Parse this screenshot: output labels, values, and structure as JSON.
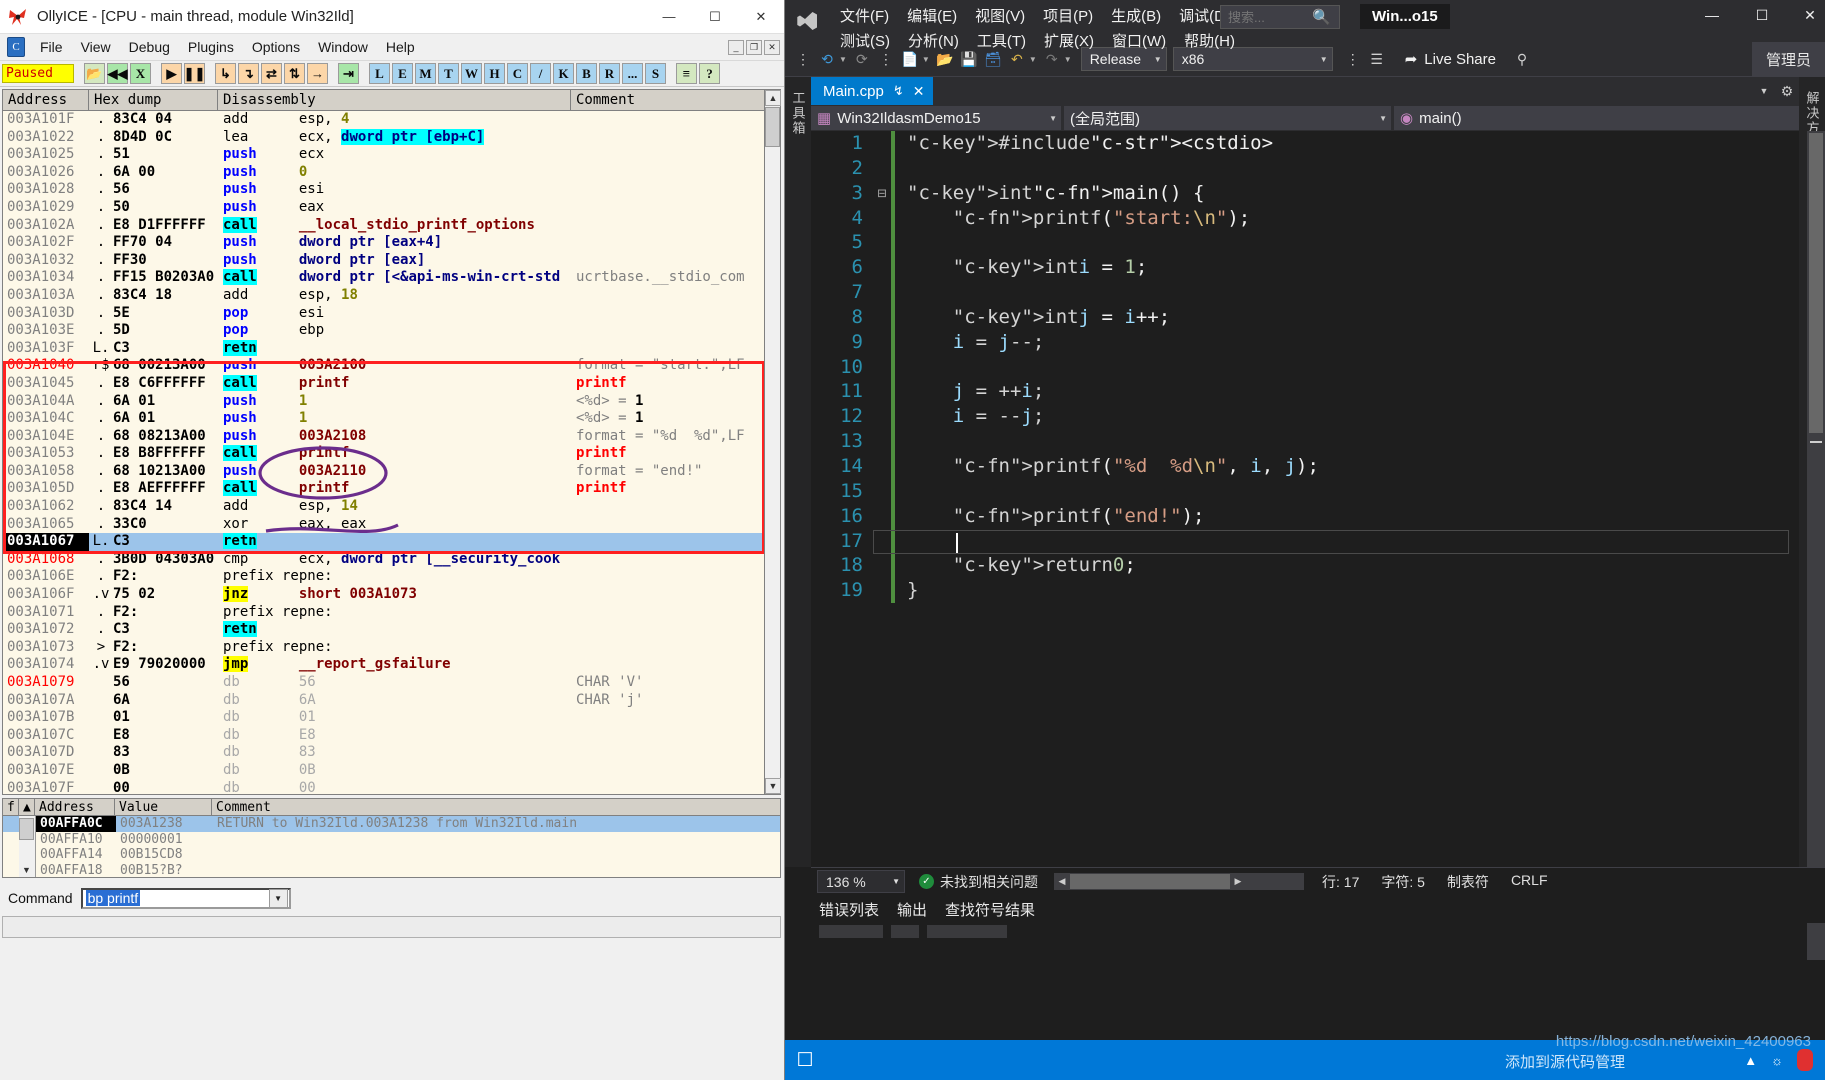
{
  "olly": {
    "window_title": "OllyICE - [CPU - main thread, module Win32Ild]",
    "window_buttons": {
      "minimize": "—",
      "maximize": "☐",
      "close": "✕"
    },
    "mdi_buttons": {
      "minimize": "_",
      "restore": "❐",
      "close": "✕"
    },
    "menu": [
      "File",
      "View",
      "Debug",
      "Plugins",
      "Options",
      "Window",
      "Help"
    ],
    "status": "Paused",
    "toolbar_letters": [
      "L",
      "E",
      "M",
      "T",
      "W",
      "H",
      "C",
      "/",
      "K",
      "B",
      "R",
      "...",
      "S"
    ],
    "cpu_columns": [
      "Address",
      "Hex dump",
      "Disassembly",
      "Comment"
    ],
    "cpu_rows": [
      {
        "addr": "003A101F",
        "mark": ".",
        "hex": "83C4 04",
        "dis": "add      esp, 4",
        "cmt": ""
      },
      {
        "addr": "003A1022",
        "mark": ".",
        "hex": "8D4D 0C",
        "dis": "lea      ecx, dword ptr [ebp+C]",
        "cmt": ""
      },
      {
        "addr": "003A1025",
        "mark": ".",
        "hex": "51",
        "dis": "push     ecx",
        "cmt": ""
      },
      {
        "addr": "003A1026",
        "mark": ".",
        "hex": "6A 00",
        "dis": "push     0",
        "cmt": ""
      },
      {
        "addr": "003A1028",
        "mark": ".",
        "hex": "56",
        "dis": "push     esi",
        "cmt": ""
      },
      {
        "addr": "003A1029",
        "mark": ".",
        "hex": "50",
        "dis": "push     eax",
        "cmt": ""
      },
      {
        "addr": "003A102A",
        "mark": ".",
        "hex": "E8 D1FFFFFF",
        "dis": "call     __local_stdio_printf_options",
        "cmt": ""
      },
      {
        "addr": "003A102F",
        "mark": ".",
        "hex": "FF70 04",
        "dis": "push     dword ptr [eax+4]",
        "cmt": ""
      },
      {
        "addr": "003A1032",
        "mark": ".",
        "hex": "FF30",
        "dis": "push     dword ptr [eax]",
        "cmt": ""
      },
      {
        "addr": "003A1034",
        "mark": ".",
        "hex": "FF15 B0203A0",
        "dis": "call     dword ptr [<&api-ms-win-crt-std",
        "cmt": "ucrtbase.__stdio_com"
      },
      {
        "addr": "003A103A",
        "mark": ".",
        "hex": "83C4 18",
        "dis": "add      esp, 18",
        "cmt": ""
      },
      {
        "addr": "003A103D",
        "mark": ".",
        "hex": "5E",
        "dis": "pop      esi",
        "cmt": ""
      },
      {
        "addr": "003A103E",
        "mark": ".",
        "hex": "5D",
        "dis": "pop      ebp",
        "cmt": ""
      },
      {
        "addr": "003A103F",
        "mark": "L.",
        "hex": "C3",
        "dis": "retn",
        "cmt": ""
      },
      {
        "addr": "003A1040",
        "mark": "r$",
        "hex": "68 00213A00",
        "dis": "push     003A2100",
        "cmt": "format = \"start:\",LF"
      },
      {
        "addr": "003A1045",
        "mark": ".",
        "hex": "E8 C6FFFFFF",
        "dis": "call     printf",
        "cmt": "printf"
      },
      {
        "addr": "003A104A",
        "mark": ".",
        "hex": "6A 01",
        "dis": "push     1",
        "cmt": "<%d> = 1"
      },
      {
        "addr": "003A104C",
        "mark": ".",
        "hex": "6A 01",
        "dis": "push     1",
        "cmt": "<%d> = 1"
      },
      {
        "addr": "003A104E",
        "mark": ".",
        "hex": "68 08213A00",
        "dis": "push     003A2108",
        "cmt": "format = \"%d  %d\",LF"
      },
      {
        "addr": "003A1053",
        "mark": ".",
        "hex": "E8 B8FFFFFF",
        "dis": "call     printf",
        "cmt": "printf"
      },
      {
        "addr": "003A1058",
        "mark": ".",
        "hex": "68 10213A00",
        "dis": "push     003A2110",
        "cmt": "format = \"end!\""
      },
      {
        "addr": "003A105D",
        "mark": ".",
        "hex": "E8 AEFFFFFF",
        "dis": "call     printf",
        "cmt": "printf"
      },
      {
        "addr": "003A1062",
        "mark": ".",
        "hex": "83C4 14",
        "dis": "add      esp, 14",
        "cmt": ""
      },
      {
        "addr": "003A1065",
        "mark": ".",
        "hex": "33C0",
        "dis": "xor      eax, eax",
        "cmt": ""
      },
      {
        "addr": "003A1067",
        "mark": "L.",
        "hex": "C3",
        "dis": "retn",
        "cmt": ""
      },
      {
        "addr": "003A1068",
        "mark": ".",
        "hex": "3B0D 04303A0",
        "dis": "cmp      ecx, dword ptr [__security_cook",
        "cmt": ""
      },
      {
        "addr": "003A106E",
        "mark": ".",
        "hex": "F2:",
        "dis": "prefix repne:",
        "cmt": ""
      },
      {
        "addr": "003A106F",
        "mark": ".v",
        "hex": "75 02",
        "dis": "jnz      short 003A1073",
        "cmt": ""
      },
      {
        "addr": "003A1071",
        "mark": ".",
        "hex": "F2:",
        "dis": "prefix repne:",
        "cmt": ""
      },
      {
        "addr": "003A1072",
        "mark": ".",
        "hex": "C3",
        "dis": "retn",
        "cmt": ""
      },
      {
        "addr": "003A1073",
        "mark": ">",
        "hex": "F2:",
        "dis": "prefix repne:",
        "cmt": ""
      },
      {
        "addr": "003A1074",
        "mark": ".v",
        "hex": "E9 79020000",
        "dis": "jmp      __report_gsfailure",
        "cmt": ""
      },
      {
        "addr": "003A1079",
        "mark": "",
        "hex": "56",
        "dis": "db       56",
        "cmt": "CHAR 'V'"
      },
      {
        "addr": "003A107A",
        "mark": "",
        "hex": "6A",
        "dis": "db       6A",
        "cmt": "CHAR 'j'"
      },
      {
        "addr": "003A107B",
        "mark": "",
        "hex": "01",
        "dis": "db       01",
        "cmt": ""
      },
      {
        "addr": "003A107C",
        "mark": "",
        "hex": "E8",
        "dis": "db       E8",
        "cmt": ""
      },
      {
        "addr": "003A107D",
        "mark": "",
        "hex": "83",
        "dis": "db       83",
        "cmt": ""
      },
      {
        "addr": "003A107E",
        "mark": "",
        "hex": "0B",
        "dis": "db       0B",
        "cmt": ""
      },
      {
        "addr": "003A107F",
        "mark": "",
        "hex": "00",
        "dis": "db       00",
        "cmt": ""
      },
      {
        "addr": "003A1080",
        "mark": "",
        "hex": "00",
        "dis": "db       00",
        "cmt": ""
      }
    ],
    "stack_columns": [
      "Address",
      "Value",
      "Comment"
    ],
    "stack_rows": [
      {
        "addr": "00AFFA0C",
        "value": "003A1238",
        "cmt": "RETURN to Win32Ild.003A1238 from Win32Ild.main"
      },
      {
        "addr": "00AFFA10",
        "value": "00000001",
        "cmt": ""
      },
      {
        "addr": "00AFFA14",
        "value": "00B15CD8",
        "cmt": ""
      },
      {
        "addr": "00AFFA18",
        "value": "00B15?B?",
        "cmt": ""
      }
    ],
    "command_label": "Command",
    "command_value": "bp printf"
  },
  "vs": {
    "logo_name": "visual-studio-logo",
    "menu_row1": [
      "文件(F)",
      "编辑(E)",
      "视图(V)",
      "项目(P)",
      "生成(B)",
      "调试(D)"
    ],
    "menu_row2": [
      "测试(S)",
      "分析(N)",
      "工具(T)",
      "扩展(X)",
      "窗口(W)",
      "帮助(H)"
    ],
    "search_placeholder": "搜索...",
    "project_badge": "Win...o15",
    "window_buttons": {
      "minimize": "—",
      "maximize": "☐",
      "close": "✕"
    },
    "toolbar": {
      "config": "Release",
      "platform": "x86",
      "live_share": "Live Share",
      "admin": "管理员"
    },
    "left_rail": "工具箱",
    "right_rail": "解决方案资源管理器",
    "tab": {
      "name": "Main.cpp",
      "pin": "↯",
      "close": "✕"
    },
    "nav": {
      "project": "Win32IldasmDemo15",
      "scope": "(全局范围)",
      "member": "main()"
    },
    "code_lines": [
      {
        "n": "1",
        "indent": 0,
        "fold": "",
        "text": "#include <cstdio>"
      },
      {
        "n": "2",
        "indent": 0,
        "fold": "",
        "text": ""
      },
      {
        "n": "3",
        "indent": 0,
        "fold": "-",
        "text": "int main() {"
      },
      {
        "n": "4",
        "indent": 1,
        "fold": "",
        "text": "printf(\"start:\\n\");"
      },
      {
        "n": "5",
        "indent": 0,
        "fold": "",
        "text": ""
      },
      {
        "n": "6",
        "indent": 1,
        "fold": "",
        "text": "int i = 1;"
      },
      {
        "n": "7",
        "indent": 0,
        "fold": "",
        "text": ""
      },
      {
        "n": "8",
        "indent": 1,
        "fold": "",
        "text": "int j = i++;"
      },
      {
        "n": "9",
        "indent": 1,
        "fold": "",
        "text": "i = j--;"
      },
      {
        "n": "10",
        "indent": 0,
        "fold": "",
        "text": ""
      },
      {
        "n": "11",
        "indent": 1,
        "fold": "",
        "text": "j = ++i;"
      },
      {
        "n": "12",
        "indent": 1,
        "fold": "",
        "text": "i = --j;"
      },
      {
        "n": "13",
        "indent": 0,
        "fold": "",
        "text": ""
      },
      {
        "n": "14",
        "indent": 1,
        "fold": "",
        "text": "printf(\"%d  %d\\n\", i, j);"
      },
      {
        "n": "15",
        "indent": 0,
        "fold": "",
        "text": ""
      },
      {
        "n": "16",
        "indent": 1,
        "fold": "",
        "text": "printf(\"end!\");"
      },
      {
        "n": "17",
        "indent": 1,
        "fold": "",
        "text": ""
      },
      {
        "n": "18",
        "indent": 1,
        "fold": "",
        "text": "return 0;"
      },
      {
        "n": "19",
        "indent": 0,
        "fold": "",
        "text": "}"
      }
    ],
    "status": {
      "zoom": "136 %",
      "issues": "未找到相关问题",
      "line": "行: 17",
      "col": "字符: 5",
      "tabs": "制表符",
      "eol": "CRLF"
    },
    "output_tabs": [
      "错误列表",
      "输出",
      "查找符号结果"
    ],
    "taskbar": {
      "watermark": "添加到源代码管理",
      "watermark_url": "https://blog.csdn.net/weixin_42400963"
    }
  },
  "colors": {
    "vs_accent": "#007acc",
    "olly_highlight": "#00ffff",
    "olly_paused_bg": "#ffff00",
    "redbox": "#ff2020",
    "scribble": "#6b2d8c"
  }
}
